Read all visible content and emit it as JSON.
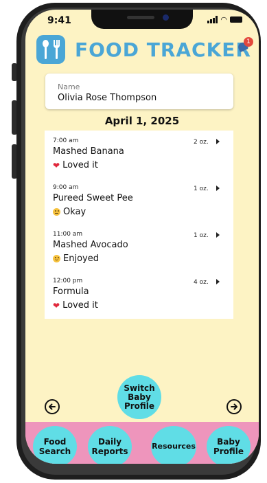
{
  "status_bar": {
    "time": "9:41"
  },
  "header": {
    "title": "FOOD TRACKER",
    "notification_count": "1",
    "brand_color": "#4aa6d6"
  },
  "name_field": {
    "label": "Name",
    "value": "Olivia Rose Thompson"
  },
  "date": "April 1, 2025",
  "log": [
    {
      "time": "7:00 am",
      "food": "Mashed Banana",
      "reaction": "Loved it",
      "reaction_icon": "heart-icon",
      "amount": "2 oz."
    },
    {
      "time": "9:00 am",
      "food": "Pureed Sweet Pee",
      "reaction": "Okay",
      "reaction_icon": "neutral-face-icon",
      "amount": "1 oz."
    },
    {
      "time": "11:00 am",
      "food": "Mashed Avocado",
      "reaction": "Enjoyed",
      "reaction_icon": "smiling-face-icon",
      "amount": "1 oz."
    },
    {
      "time": "12:00 pm",
      "food": "Formula",
      "reaction": "Loved it",
      "reaction_icon": "heart-icon",
      "amount": "4 oz."
    }
  ],
  "switch_profile": {
    "line1": "Switch",
    "line2": "Baby",
    "line3": "Profile"
  },
  "nav": [
    {
      "line1": "Food",
      "line2": "Search"
    },
    {
      "line1": "Daily",
      "line2": "Reports"
    },
    {
      "line1": "Resources",
      "line2": ""
    },
    {
      "line1": "Baby",
      "line2": "Profile"
    }
  ],
  "colors": {
    "screen_bg": "#fdf3c4",
    "button_cyan": "#60dde6",
    "nav_pink": "#ee95bc",
    "badge_red": "#e2483c"
  }
}
